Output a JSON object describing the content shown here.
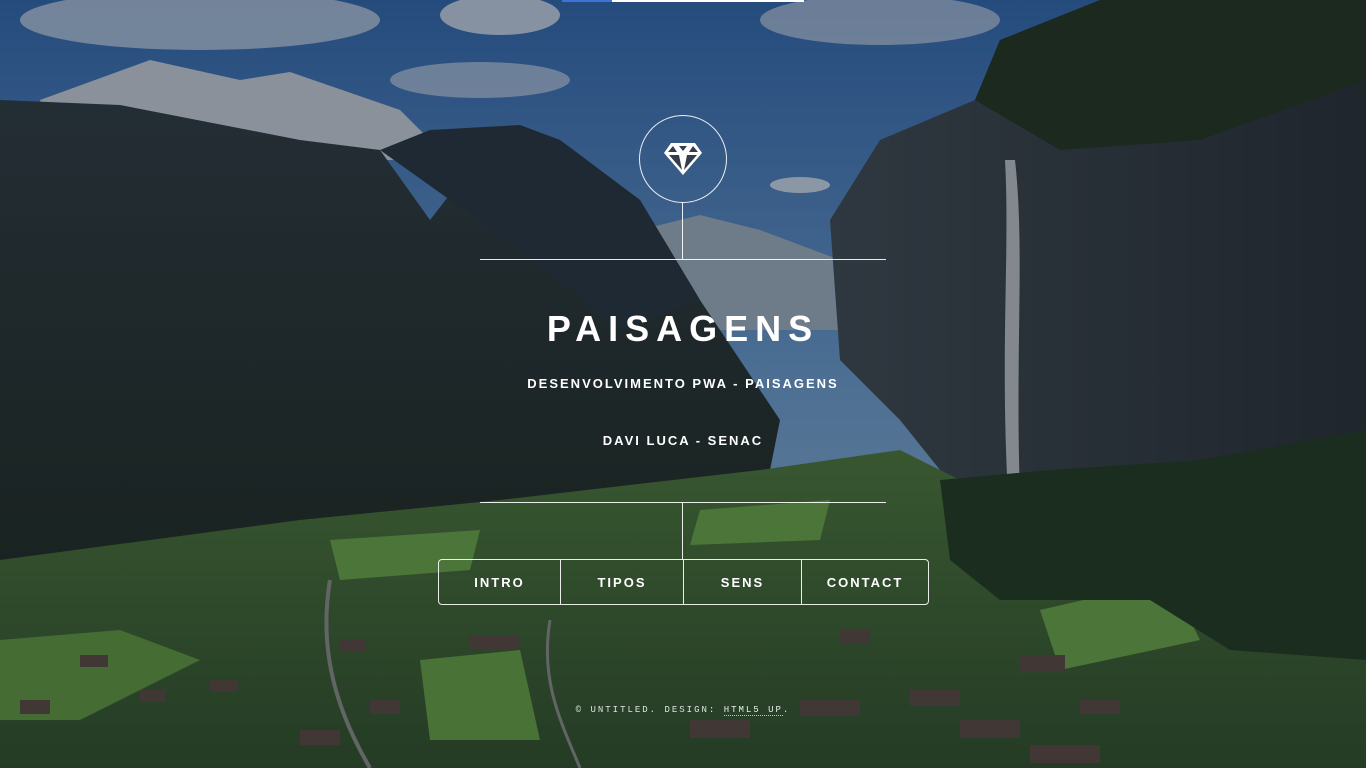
{
  "header": {
    "logo_icon": "diamond-icon",
    "title": "PAISAGENS",
    "subtitle": "DESENVOLVIMENTO PWA - PAISAGENS",
    "author": "DAVI LUCA - SENAC"
  },
  "nav": {
    "items": [
      {
        "label": "INTRO"
      },
      {
        "label": "TIPOS"
      },
      {
        "label": "SENS"
      },
      {
        "label": "CONTACT"
      }
    ]
  },
  "footer": {
    "copyright": "© UNTITLED. DESIGN: ",
    "design_link": "HTML5 UP",
    "end": "."
  },
  "colors": {
    "sky": "#3f7fc4",
    "valley_green": "#4f8f3a",
    "accent_bar": "#3d73d6",
    "text": "#ffffff"
  }
}
